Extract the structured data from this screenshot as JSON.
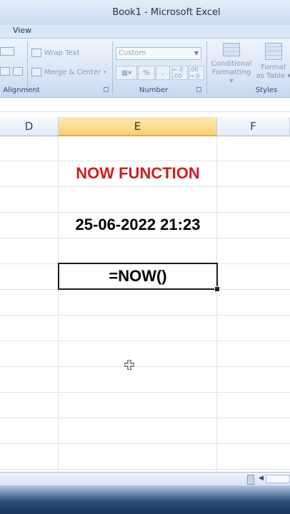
{
  "window": {
    "title": "Book1 - Microsoft Excel"
  },
  "menu": {
    "view_label": "View"
  },
  "ribbon": {
    "alignment_group_label": "Alignment",
    "wrap_text_label": "Wrap Text",
    "merge_center_label": "Merge & Center",
    "number_group_label": "Number",
    "number_format_value": "Custom",
    "percent_label": "%",
    "comma_label": ",",
    "increase_decimal_label": "←.0 .00",
    "decrease_decimal_label": ".00 →.0",
    "conditional_formatting_label_1": "Conditional",
    "conditional_formatting_label_2": "Formatting ▾",
    "format_table_label_1": "Format",
    "format_table_label_2": "as Table ▾",
    "styles_group_label": "Styles"
  },
  "columns": [
    {
      "label": "D",
      "selected": false
    },
    {
      "label": "E",
      "selected": true
    },
    {
      "label": "F",
      "selected": false
    }
  ],
  "cells": {
    "title": "NOW FUNCTION",
    "datetime": "25-06-2022 21:23",
    "formula": "=NOW()"
  },
  "colors": {
    "title_red": "#cc1f1f",
    "selected_header": "#f8cf73",
    "ribbon_blue": "#d5e3f4"
  },
  "icons": [
    "indent-icon",
    "align-icon",
    "wrap-text-icon",
    "merge-center-icon",
    "currency-icon",
    "conditional-formatting-icon",
    "format-table-icon",
    "cell-cursor-icon"
  ]
}
